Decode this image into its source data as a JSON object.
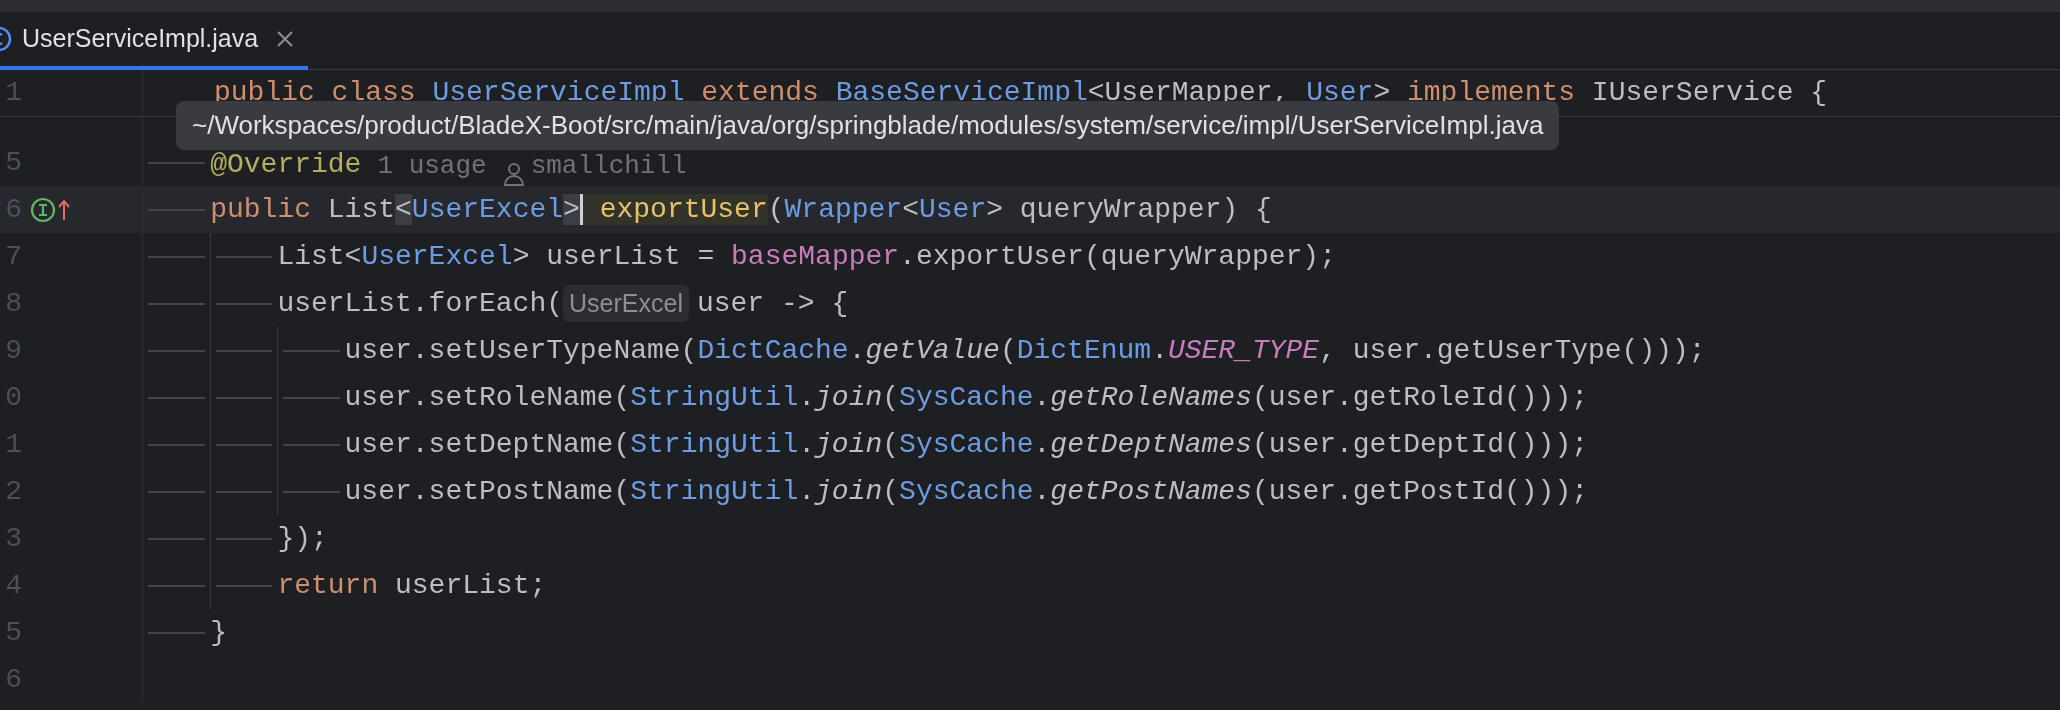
{
  "tabs": [
    {
      "label": "UserServiceImpl.java",
      "selected": true
    }
  ],
  "sticky_line": {
    "number": "1",
    "tokens": [
      {
        "text": "public class ",
        "kind": "keyword"
      },
      {
        "text": "UserServiceImpl ",
        "kind": "type"
      },
      {
        "text": "extends ",
        "kind": "keyword"
      },
      {
        "text": "BaseServiceImpl",
        "kind": "type"
      },
      {
        "text": "<UserMapper, ",
        "kind": "plain"
      },
      {
        "text": "User",
        "kind": "type"
      },
      {
        "text": "> ",
        "kind": "plain"
      },
      {
        "text": "implements",
        "kind": "keyword"
      },
      {
        "text": " IUserService {",
        "kind": "plain"
      }
    ]
  },
  "tooltip": "~/Workspaces/product/BladeX-Boot/src/main/java/org/springblade/modules/system/service/impl/UserServiceImpl.java",
  "lines": [
    {
      "number": "5",
      "current": false,
      "tokens": [
        {
          "text": "@Override",
          "kind": "annotation"
        },
        {
          "text": "1 usage",
          "kind": "lens"
        },
        {
          "text": "smallchill",
          "kind": "author"
        }
      ]
    },
    {
      "number": "6",
      "overrides": true,
      "current": true,
      "tokens": [
        {
          "text": "public",
          "kind": "keyword"
        },
        {
          "text": " List",
          "kind": "plain"
        },
        {
          "text": "<",
          "kind": "brace"
        },
        {
          "text": "UserExcel",
          "kind": "type"
        },
        {
          "text": ">",
          "kind": "brace"
        },
        {
          "text": " exportUser",
          "kind": "declaration"
        },
        {
          "text": "(",
          "kind": "plain"
        },
        {
          "text": "Wrapper",
          "kind": "type"
        },
        {
          "text": "<",
          "kind": "plain"
        },
        {
          "text": "User",
          "kind": "type"
        },
        {
          "text": "> queryWrapper) {",
          "kind": "plain"
        }
      ],
      "children": [
        {
          "number": "7",
          "current": false,
          "tokens": [
            {
              "text": "List<",
              "kind": "plain"
            },
            {
              "text": "UserExcel",
              "kind": "type"
            },
            {
              "text": "> userList = ",
              "kind": "plain"
            },
            {
              "text": "baseMapper",
              "kind": "field"
            },
            {
              "text": ".exportUser(queryWrapper);",
              "kind": "plain"
            }
          ]
        },
        {
          "number": "8",
          "current": false,
          "tokens": [
            {
              "text": "userList.forEach(",
              "kind": "plain"
            },
            {
              "text": "UserExcel",
              "kind": "hint"
            },
            {
              "text": "user -> {",
              "kind": "plain"
            }
          ],
          "children": [
            {
              "number": "9",
              "current": false,
              "tokens": [
                {
                  "text": "user.setUserTypeName(",
                  "kind": "plain"
                },
                {
                  "text": "DictCache",
                  "kind": "type"
                },
                {
                  "text": ".",
                  "kind": "plain"
                },
                {
                  "text": "getValue",
                  "kind": "static-method"
                },
                {
                  "text": "(",
                  "kind": "plain"
                },
                {
                  "text": "DictEnum",
                  "kind": "type"
                },
                {
                  "text": ".",
                  "kind": "plain"
                },
                {
                  "text": "USER_TYPE",
                  "kind": "constant"
                },
                {
                  "text": ", user.getUserType()));",
                  "kind": "plain"
                }
              ]
            },
            {
              "number": "0",
              "current": false,
              "tokens": [
                {
                  "text": "user.setRoleName(",
                  "kind": "plain"
                },
                {
                  "text": "StringUtil",
                  "kind": "type"
                },
                {
                  "text": ".",
                  "kind": "plain"
                },
                {
                  "text": "join",
                  "kind": "static-method"
                },
                {
                  "text": "(",
                  "kind": "plain"
                },
                {
                  "text": "SysCache",
                  "kind": "type"
                },
                {
                  "text": ".",
                  "kind": "plain"
                },
                {
                  "text": "getRoleNames",
                  "kind": "static-method"
                },
                {
                  "text": "(user.getRoleId()));",
                  "kind": "plain"
                }
              ]
            },
            {
              "number": "1",
              "current": false,
              "tokens": [
                {
                  "text": "user.setDeptName(",
                  "kind": "plain"
                },
                {
                  "text": "StringUtil",
                  "kind": "type"
                },
                {
                  "text": ".",
                  "kind": "plain"
                },
                {
                  "text": "join",
                  "kind": "static-method"
                },
                {
                  "text": "(",
                  "kind": "plain"
                },
                {
                  "text": "SysCache",
                  "kind": "type"
                },
                {
                  "text": ".",
                  "kind": "plain"
                },
                {
                  "text": "getDeptNames",
                  "kind": "static-method"
                },
                {
                  "text": "(user.getDeptId()));",
                  "kind": "plain"
                }
              ]
            },
            {
              "number": "2",
              "current": false,
              "tokens": [
                {
                  "text": "user.setPostName(",
                  "kind": "plain"
                },
                {
                  "text": "StringUtil",
                  "kind": "type"
                },
                {
                  "text": ".",
                  "kind": "plain"
                },
                {
                  "text": "join",
                  "kind": "static-method"
                },
                {
                  "text": "(",
                  "kind": "plain"
                },
                {
                  "text": "SysCache",
                  "kind": "type"
                },
                {
                  "text": ".",
                  "kind": "plain"
                },
                {
                  "text": "getPostNames",
                  "kind": "static-method"
                },
                {
                  "text": "(user.getPostId()));",
                  "kind": "plain"
                }
              ]
            }
          ]
        },
        {
          "number": "3",
          "current": false,
          "tokens": [
            {
              "text": "});",
              "kind": "plain"
            }
          ]
        },
        {
          "number": "4",
          "current": false,
          "tokens": [
            {
              "text": "return",
              "kind": "keyword"
            },
            {
              "text": " userList;",
              "kind": "plain"
            }
          ]
        }
      ]
    },
    {
      "number": "5",
      "current": false,
      "tokens": [
        {
          "text": "}",
          "kind": "plain"
        }
      ]
    }
  ],
  "trailing_line": {
    "number": "6",
    "current": false
  }
}
